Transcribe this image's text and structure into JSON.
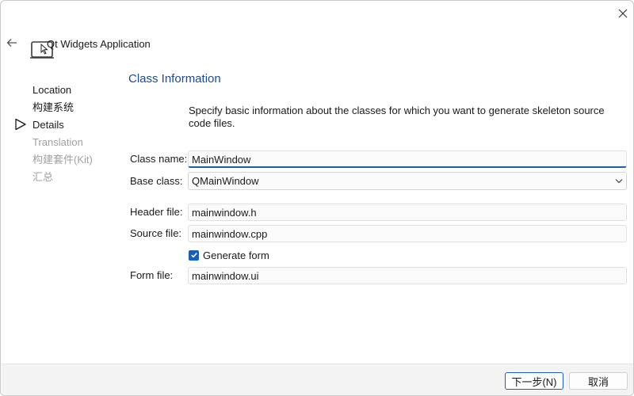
{
  "window": {
    "title": "Qt Widgets Application"
  },
  "steps": [
    {
      "label": "Location",
      "enabled": true
    },
    {
      "label": "构建系统",
      "enabled": true
    },
    {
      "label": "Details",
      "enabled": true,
      "current": true
    },
    {
      "label": "Translation",
      "enabled": false
    },
    {
      "label": "构建套件(Kit)",
      "enabled": false
    },
    {
      "label": "汇总",
      "enabled": false
    }
  ],
  "page": {
    "title": "Class Information",
    "description": "Specify basic information about the classes for which you want to generate skeleton source code files."
  },
  "form": {
    "class_name": {
      "label": "Class name:",
      "value": "MainWindow"
    },
    "base_class": {
      "label": "Base class:",
      "value": "QMainWindow"
    },
    "header_file": {
      "label": "Header file:",
      "value": "mainwindow.h"
    },
    "source_file": {
      "label": "Source file:",
      "value": "mainwindow.cpp"
    },
    "generate_form": {
      "label": "Generate form",
      "checked": true
    },
    "form_file": {
      "label": "Form file:",
      "value": "mainwindow.ui"
    }
  },
  "footer": {
    "next_label": "下一步(N)",
    "cancel_label": "取消"
  },
  "icons": {
    "close": "close-icon",
    "back": "back-arrow-icon",
    "wizard": "laptop-cursor-icon",
    "current_step": "triangle-right-icon",
    "dropdown": "chevron-down-icon",
    "checkmark": "checkmark-icon"
  },
  "colors": {
    "accent": "#1a5fb4",
    "page_title": "#1c4a8c",
    "disabled_text": "#a0a0a0",
    "footer_bg": "#f3f3f3"
  }
}
